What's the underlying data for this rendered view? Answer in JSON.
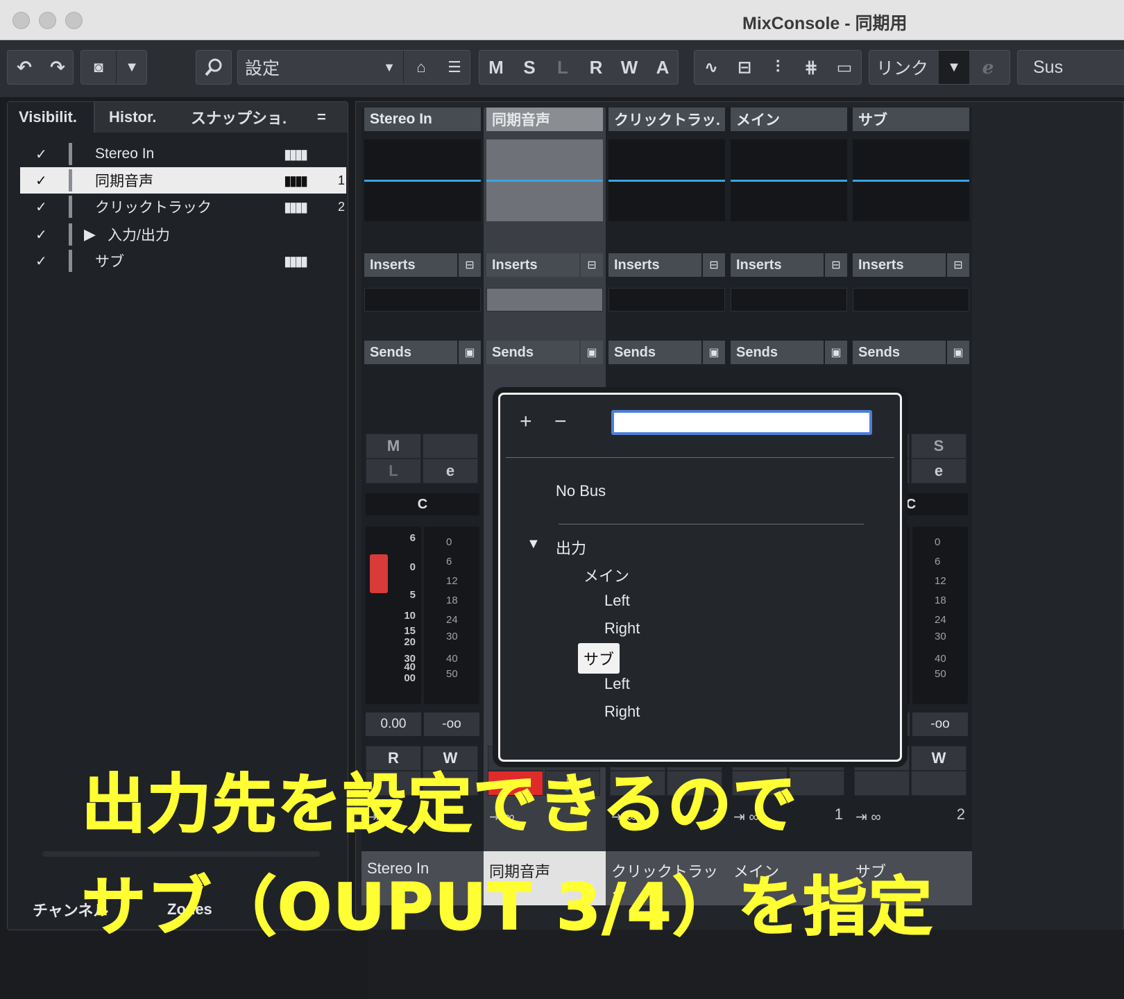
{
  "window": {
    "title": "MixConsole - 同期用"
  },
  "toolbar": {
    "settings_label": "設定",
    "m": "M",
    "s": "S",
    "l": "L",
    "r": "R",
    "w": "W",
    "a": "A",
    "link_label": "リンク",
    "sus_label": "Sus"
  },
  "left_panel": {
    "tabs": [
      "Visibilit.",
      "Histor.",
      "スナップショ.",
      "="
    ],
    "tracks": [
      {
        "check": "✓",
        "name": "Stereo In",
        "num": ""
      },
      {
        "check": "✓",
        "name": "同期音声",
        "num": "1"
      },
      {
        "check": "✓",
        "name": "クリックトラック",
        "num": "2"
      },
      {
        "check": "✓",
        "name": "入力/出力",
        "num": ""
      },
      {
        "check": "✓",
        "name": "サブ",
        "num": ""
      }
    ],
    "bottom_tabs": [
      "チャンネル",
      "Zones"
    ]
  },
  "strips": [
    {
      "header": "Stereo In",
      "footer": "Stereo In",
      "num": ""
    },
    {
      "header": "同期音声",
      "footer": "同期音声",
      "num": ""
    },
    {
      "header": "クリックトラッ.",
      "footer": "クリックトラック",
      "num": "2"
    },
    {
      "header": "メイン",
      "footer": "メイン",
      "num": "1"
    },
    {
      "header": "サブ",
      "footer": "サブ",
      "num": "2"
    }
  ],
  "strip_labels": {
    "inserts": "Inserts",
    "sends": "Sends",
    "pan": "C",
    "volume": "0.00",
    "peak": "-oo",
    "read": "R",
    "write": "W",
    "mute": "M",
    "solo": "S",
    "listen": "L",
    "edit": "e"
  },
  "fader_scale": [
    "6",
    "0",
    "5",
    "10",
    "15",
    "20",
    "30",
    "40",
    "00"
  ],
  "meter_scale": [
    "0",
    "6",
    "12",
    "18",
    "24",
    "30",
    "40",
    "50"
  ],
  "popup": {
    "plus": "+",
    "minus": "−",
    "search_value": "",
    "no_bus": "No Bus",
    "group": "出力",
    "items": [
      "メイン",
      "Left",
      "Right",
      "サブ",
      "Left",
      "Right"
    ],
    "selected": "サブ"
  },
  "caption": {
    "line1": "出力先を設定できるので",
    "line2": "サブ（OUPUT 3/4）を指定"
  },
  "colors": {
    "accent_blue": "#3aa3e6",
    "caption_yellow": "#ffff33",
    "fader_red": "#d93a3a",
    "record_red": "#e02b2b"
  }
}
